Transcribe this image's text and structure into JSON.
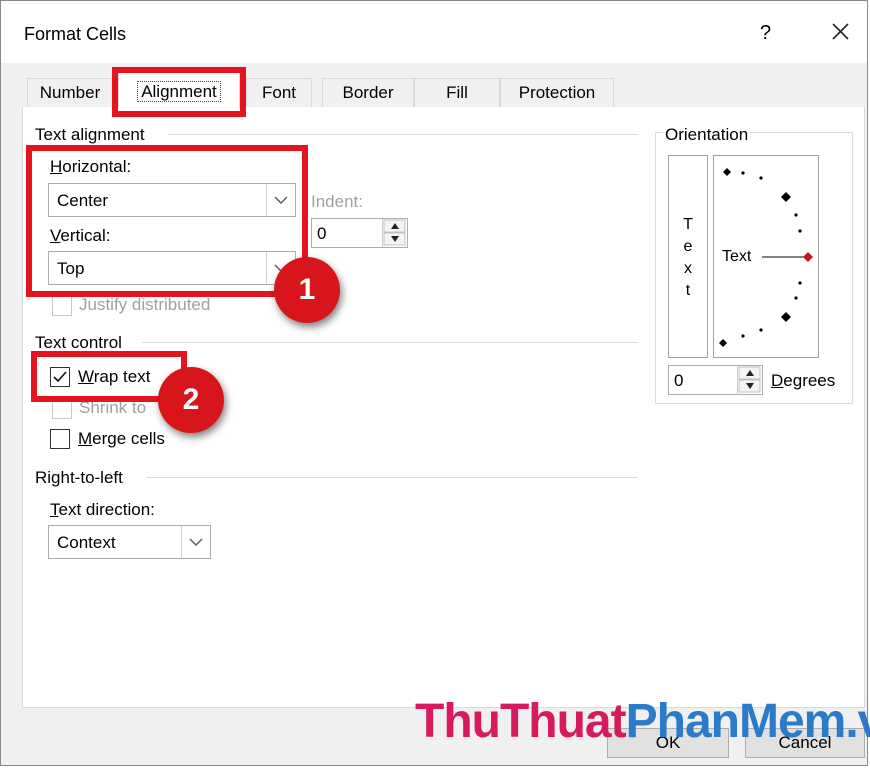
{
  "window": {
    "title": "Format Cells",
    "help_label": "?"
  },
  "tabs": [
    {
      "label": "Number"
    },
    {
      "label": "Alignment",
      "active": true
    },
    {
      "label": "Font"
    },
    {
      "label": "Border"
    },
    {
      "label": "Fill"
    },
    {
      "label": "Protection"
    }
  ],
  "text_alignment": {
    "group_title": "Text alignment",
    "horizontal_label": "Horizontal:",
    "horizontal_value": "Center",
    "vertical_label": "Vertical:",
    "vertical_value": "Top",
    "indent_label": "Indent:",
    "indent_value": "0",
    "justify_distributed_label": "Justify distributed"
  },
  "text_control": {
    "group_title": "Text control",
    "wrap_text_label": "Wrap text",
    "wrap_text_checked": true,
    "shrink_to_fit_label": "Shrink to",
    "merge_cells_label": "Merge cells",
    "merge_cells_checked": false
  },
  "right_to_left": {
    "group_title": "Right-to-left",
    "text_direction_label": "Text direction:",
    "text_direction_value": "Context"
  },
  "orientation": {
    "group_title": "Orientation",
    "vertical_text_letters": [
      "T",
      "e",
      "x",
      "t"
    ],
    "dial_text": "Text",
    "degrees_value": "0",
    "degrees_label": "Degrees"
  },
  "footer": {
    "ok_label": "OK",
    "cancel_label": "Cancel"
  },
  "annotations": {
    "badge_1": "1",
    "badge_2": "2",
    "highlight_color": "#e4151f"
  },
  "watermark": {
    "part1": "ThuThuat",
    "part2": "PhanMem",
    "part3": ".vn"
  }
}
